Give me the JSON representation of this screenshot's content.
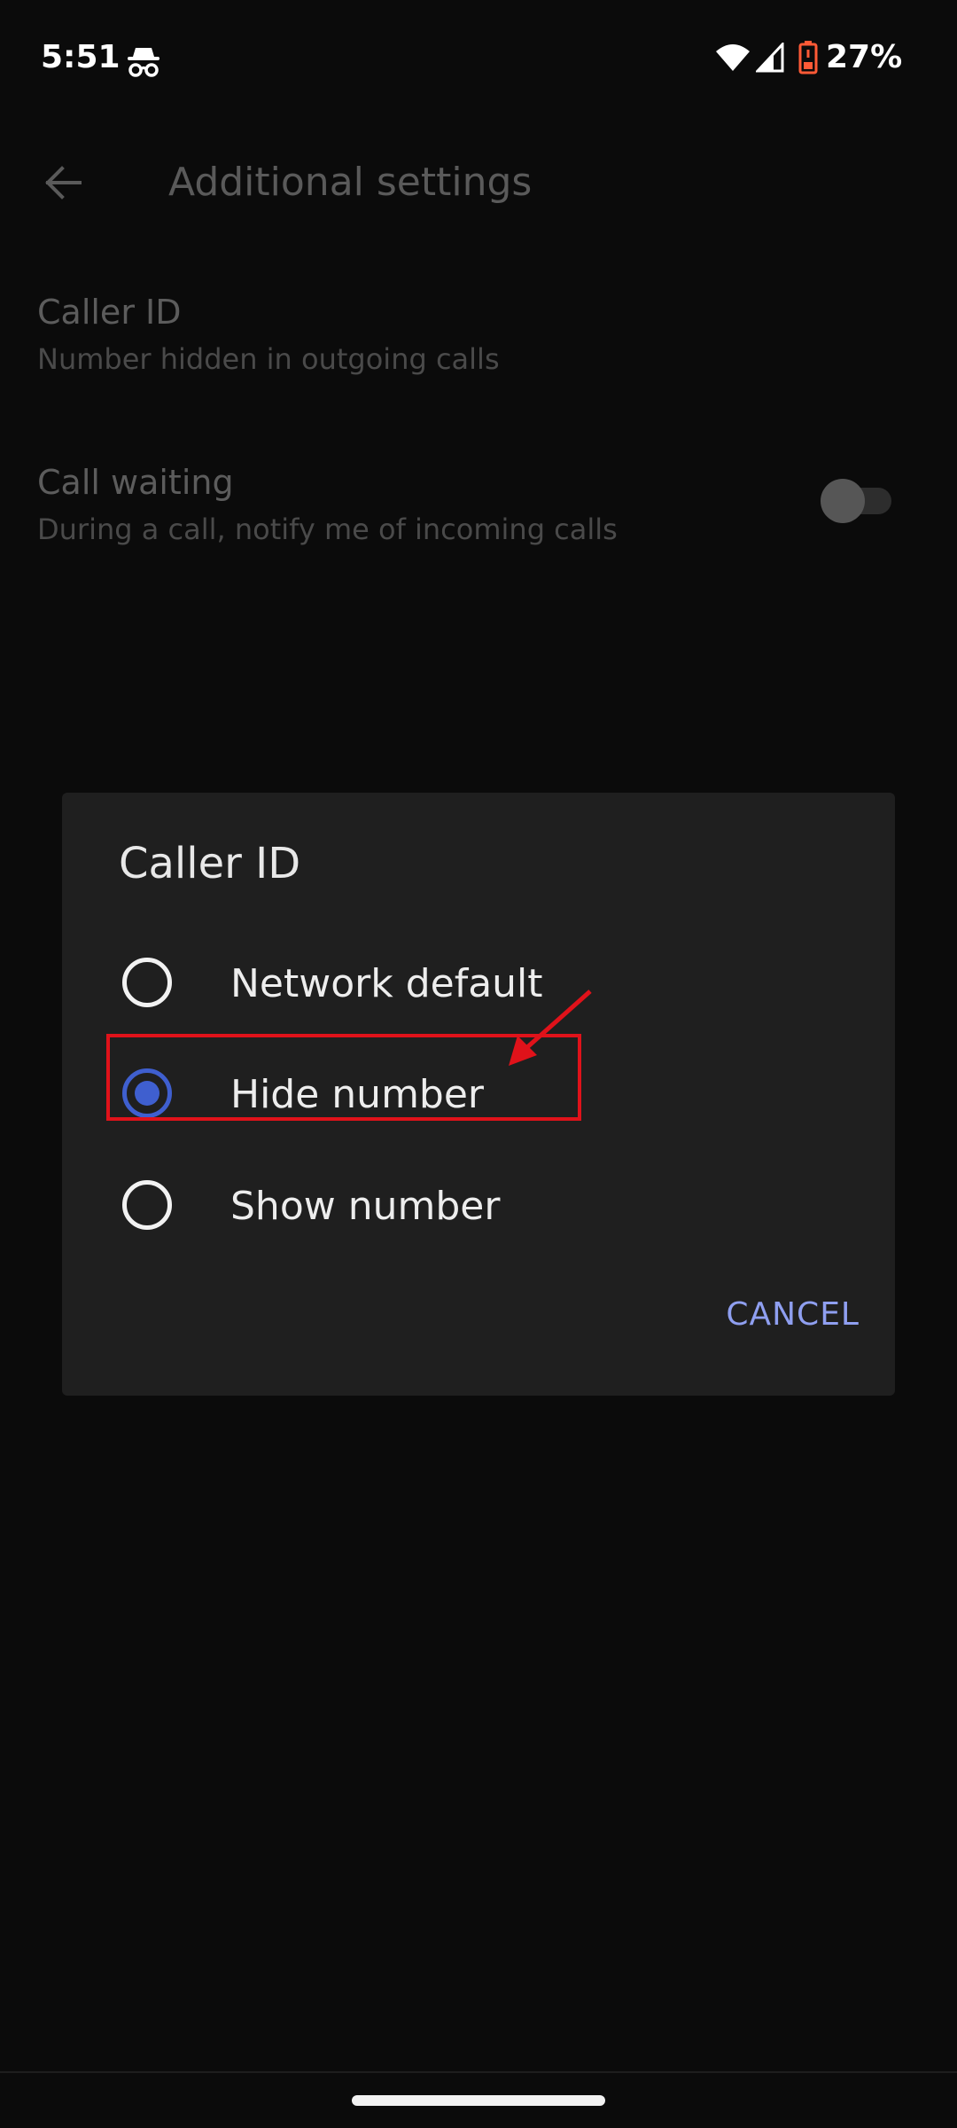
{
  "status_bar": {
    "time": "5:51",
    "battery": "27%",
    "icons": [
      "incognito-icon",
      "wifi-icon",
      "signal-icon",
      "battery-icon"
    ]
  },
  "header": {
    "title": "Additional settings",
    "back_icon": "arrow-back-icon"
  },
  "settings": {
    "caller_id": {
      "title": "Caller ID",
      "subtitle": "Number hidden in outgoing calls"
    },
    "call_waiting": {
      "title": "Call waiting",
      "subtitle": "During a call, notify me of incoming calls",
      "enabled": false
    }
  },
  "dialog": {
    "title": "Caller ID",
    "options": [
      {
        "label": "Network default",
        "selected": false
      },
      {
        "label": "Hide number",
        "selected": true
      },
      {
        "label": "Show number",
        "selected": false
      }
    ],
    "cancel_label": "CANCEL"
  },
  "colors": {
    "accent": "#3f5fcf",
    "cancel_text": "#8f9ff0",
    "annotation": "#e0121a",
    "battery_low": "#ff5a36"
  }
}
